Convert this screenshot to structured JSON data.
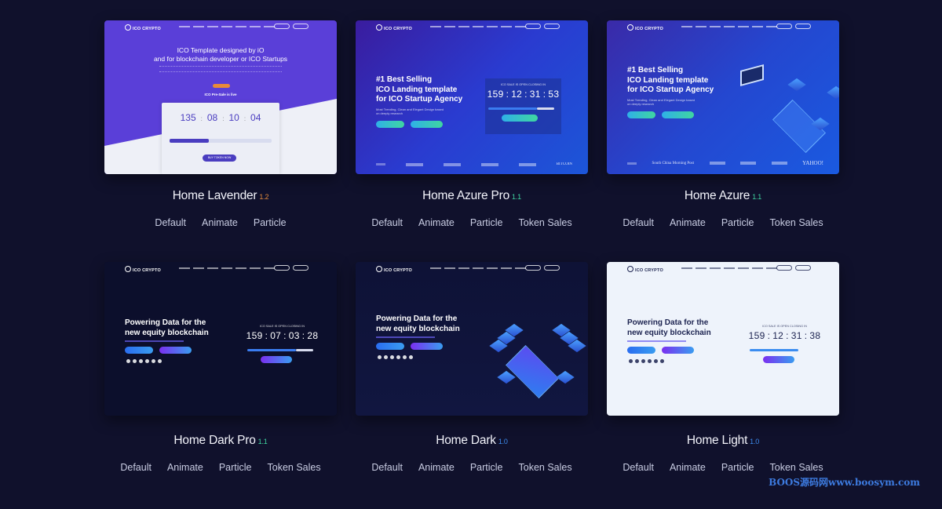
{
  "templates": [
    {
      "name": "Home Lavender",
      "version": "1.2",
      "version_color": "#e38a3c",
      "theme": "lavender",
      "links": [
        "Default",
        "Animate",
        "Particle"
      ],
      "thumb": {
        "logo": "ICO CRYPTO",
        "heading": [
          "ICO Template designed by iO",
          "and for blockchain developer or ICO Startups"
        ],
        "badge": "ICO Pre-Sale is live",
        "countdown": [
          "135",
          "08",
          "10",
          "04"
        ],
        "button": "BUY TOKEN NOW"
      }
    },
    {
      "name": "Home Azure Pro",
      "version": "1.1",
      "version_color": "#3fd6a0",
      "theme": "azure-pro",
      "links": [
        "Default",
        "Animate",
        "Particle",
        "Token Sales"
      ],
      "thumb": {
        "logo": "ICO CRYPTO",
        "heading": [
          "#1 Best Selling",
          "ICO Landing template",
          "for ICO Startup Agency"
        ],
        "sub": "Most Trending, Clean and Elegant Design based on deeply research",
        "countdown_title": "ICO SALE IS OPEN CLOSING IN",
        "countdown": [
          "159",
          "12",
          "31",
          "53"
        ],
        "logos": [
          "BITCOIN"
        ]
      }
    },
    {
      "name": "Home Azure",
      "version": "1.1",
      "version_color": "#3fd6a0",
      "theme": "azure",
      "links": [
        "Default",
        "Animate",
        "Particle",
        "Token Sales"
      ],
      "thumb": {
        "logo": "ICO CRYPTO",
        "heading": [
          "#1 Best Selling",
          "ICO Landing template",
          "for ICO Startup Agency"
        ],
        "sub": "Most Trending, Clean and Elegant Design based on deeply research",
        "logos": [
          "South China Morning Post",
          "YAHOO!"
        ]
      }
    },
    {
      "name": "Home Dark Pro",
      "version": "1.1",
      "version_color": "#3fd6a0",
      "theme": "dark-pro",
      "links": [
        "Default",
        "Animate",
        "Particle",
        "Token Sales"
      ],
      "thumb": {
        "logo": "ICO CRYPTO",
        "heading": [
          "Powering Data for the",
          "new equity blockchain"
        ],
        "countdown_title": "ICO SALE IS OPEN CLOSING IN",
        "countdown": [
          "159",
          "07",
          "03",
          "28"
        ]
      }
    },
    {
      "name": "Home Dark",
      "version": "1.0",
      "version_color": "#3d8cf0",
      "theme": "dark",
      "links": [
        "Default",
        "Animate",
        "Particle",
        "Token Sales"
      ],
      "thumb": {
        "logo": "ICO CRYPTO",
        "heading": [
          "Powering Data for the",
          "new equity blockchain"
        ]
      }
    },
    {
      "name": "Home Light",
      "version": "1.0",
      "version_color": "#3d8cf0",
      "theme": "light",
      "links": [
        "Default",
        "Animate",
        "Particle",
        "Token Sales"
      ],
      "thumb": {
        "logo": "ICO CRYPTO",
        "heading": [
          "Powering Data for the",
          "new equity blockchain"
        ],
        "countdown_title": "ICO SALE IS OPEN CLOSING IN",
        "countdown": [
          "159",
          "12",
          "31",
          "38"
        ]
      }
    }
  ],
  "watermark": "BOOS源码网www.boosym.com"
}
